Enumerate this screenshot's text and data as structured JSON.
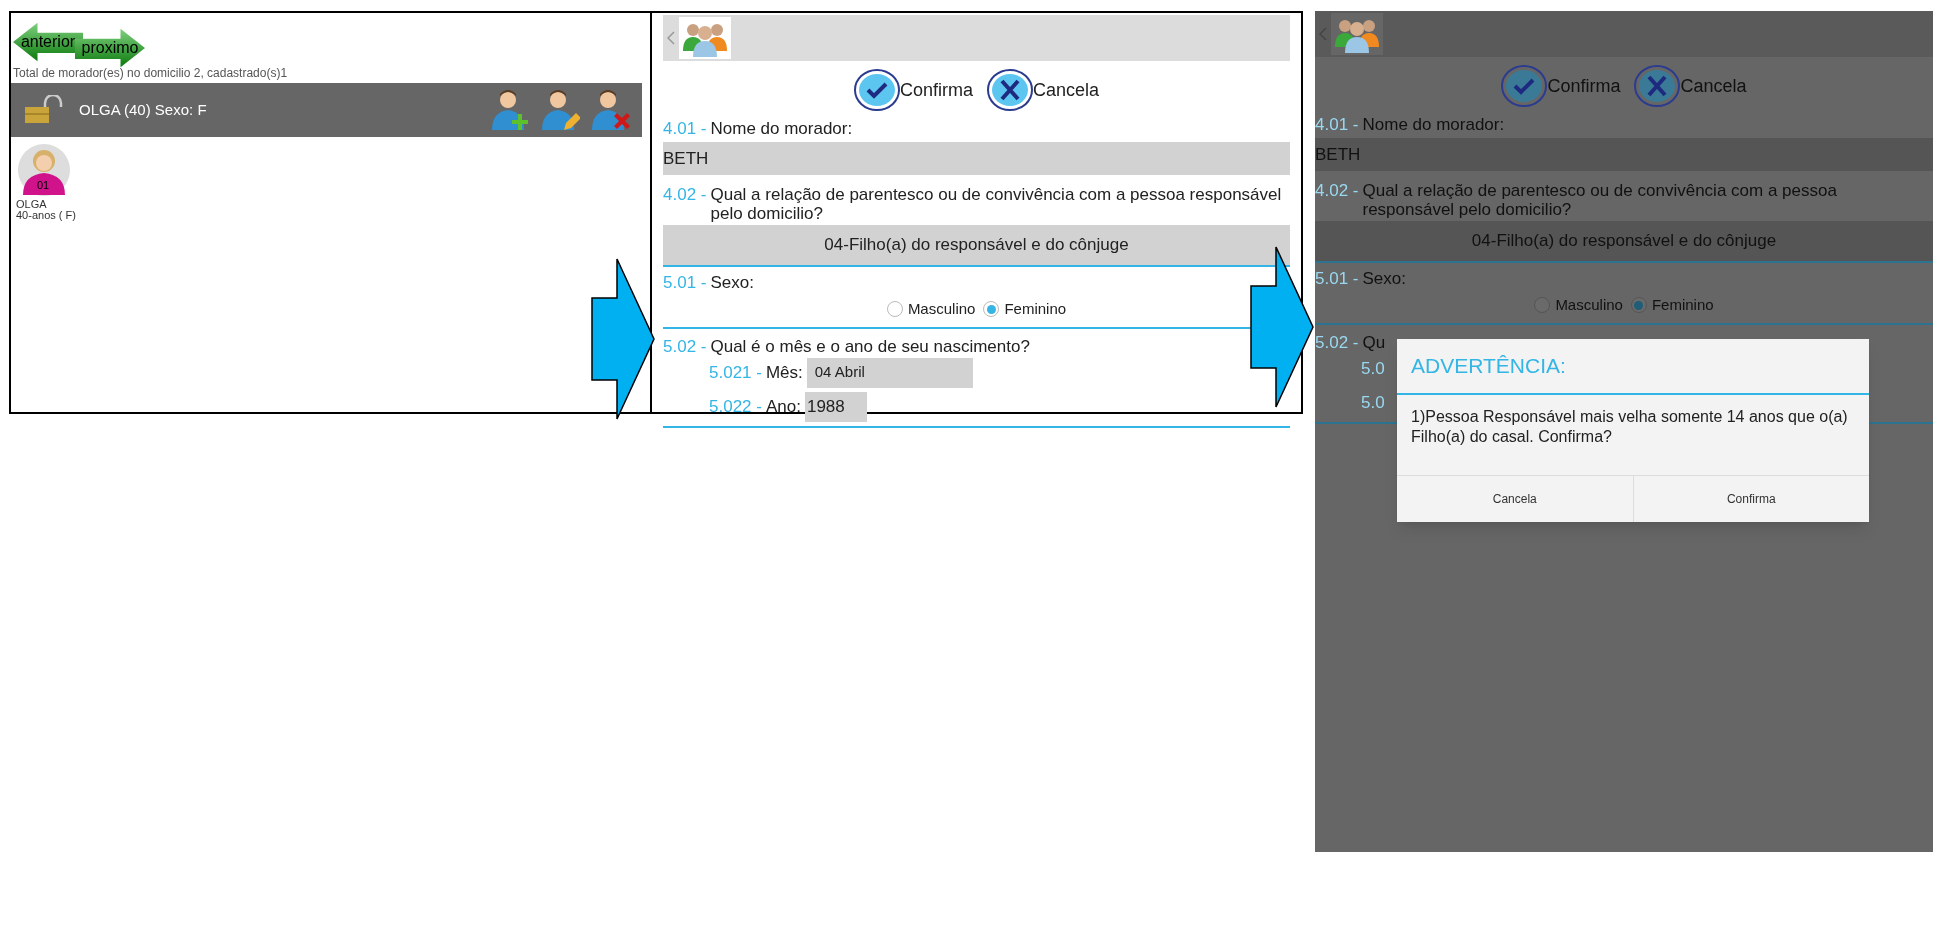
{
  "list_screen": {
    "nav": [
      {
        "label": "anterior",
        "kind": "back"
      },
      {
        "label": "proximo",
        "kind": "next"
      }
    ],
    "summary": "Total de morador(es) no domicilio 2, cadastrado(s)1",
    "resident_bar": {
      "label": "OLGA (40) Sexo: F"
    },
    "residents": [
      {
        "badge": "01",
        "name": "OLGA",
        "age": "40-anos ( F)"
      }
    ]
  },
  "form_screen": {
    "actions": [
      {
        "label": "Confirma",
        "kind": "confirm"
      },
      {
        "label": "Cancela",
        "kind": "cancel"
      }
    ],
    "questions": [
      {
        "kind": "text",
        "number": "4.01 -",
        "label": "Nome do morador:",
        "value": "BETH"
      },
      {
        "kind": "choice",
        "number": "4.02 -",
        "label": "Qual a relação de parentesco ou de convivência com a pessoa responsável pelo domicilio?",
        "value": "04-Filho(a) do responsável e do cônjuge"
      },
      {
        "kind": "radio",
        "number": "5.01 -",
        "label": "Sexo:",
        "options": [
          {
            "label": "Masculino",
            "selected": false
          },
          {
            "label": "Feminino",
            "selected": true
          }
        ]
      },
      {
        "kind": "date",
        "number": "5.02 -",
        "label": "Qual é o mês e o ano de seu nascimento?",
        "parts": [
          {
            "number": "5.021 -",
            "label": "Mês:",
            "value": "04 Abril"
          },
          {
            "number": "5.022 -",
            "label": "Ano:",
            "value": "1988"
          }
        ]
      }
    ]
  },
  "dimmed_screen": {
    "actions": [
      {
        "label": "Confirma",
        "kind": "confirm"
      },
      {
        "label": "Cancela",
        "kind": "cancel"
      }
    ],
    "questions": [
      {
        "kind": "text",
        "number": "4.01 -",
        "label": "Nome do morador:",
        "value": "BETH"
      },
      {
        "kind": "choice",
        "number": "4.02 -",
        "label": "Qual a relação de parentesco ou de convivência com a pessoa responsável pelo domicilio?",
        "value": "04-Filho(a) do responsável e do cônjuge"
      },
      {
        "kind": "radio",
        "number": "5.01 -",
        "label": "Sexo:",
        "options": [
          {
            "label": "Masculino",
            "selected": false
          },
          {
            "label": "Feminino",
            "selected": true
          }
        ]
      },
      {
        "kind": "date",
        "number": "5.02 -",
        "label": "Qu",
        "parts": [
          {
            "number": "5.0"
          },
          {
            "number": "5.0"
          }
        ]
      }
    ],
    "dialog": {
      "title": "ADVERTÊNCIA:",
      "message": "1)Pessoa Responsável mais velha somente 14 anos que o(a) Filho(a) do casal. Confirma?",
      "buttons": [
        "Cancela",
        "Confirma"
      ]
    }
  }
}
